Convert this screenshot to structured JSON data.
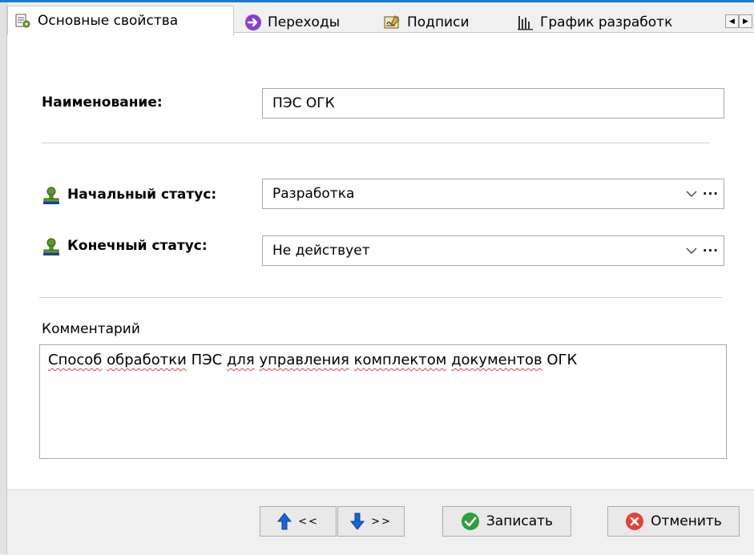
{
  "tabs": [
    {
      "label": "Основные свойства",
      "icon": "properties-icon",
      "active": true
    },
    {
      "label": "Переходы",
      "icon": "transition-arrow-icon",
      "active": false
    },
    {
      "label": "Подписи",
      "icon": "signature-icon",
      "active": false
    },
    {
      "label": "График разработк",
      "icon": "bar-chart-icon",
      "active": false
    }
  ],
  "form": {
    "name_label": "Наименование:",
    "name_value": "ПЭС ОГК",
    "start_status_label": "Начальный статус:",
    "start_status_value": "Разработка",
    "end_status_label": "Конечный статус:",
    "end_status_value": "Не действует",
    "comment_label": "Комментарий",
    "comment_words": [
      "Способ",
      "обработки",
      "ПЭС",
      "для",
      "управления",
      "комплектом",
      "документов",
      "ОГК"
    ],
    "ellipsis": "···"
  },
  "buttons": {
    "prev_label": "<<",
    "next_label": ">>",
    "save_label": "Записать",
    "cancel_label": "Отменить"
  },
  "colors": {
    "accent": "#1a7ad6",
    "save_green": "#2e9e3e",
    "cancel_red": "#e0433a",
    "nav_blue": "#1565d8"
  }
}
